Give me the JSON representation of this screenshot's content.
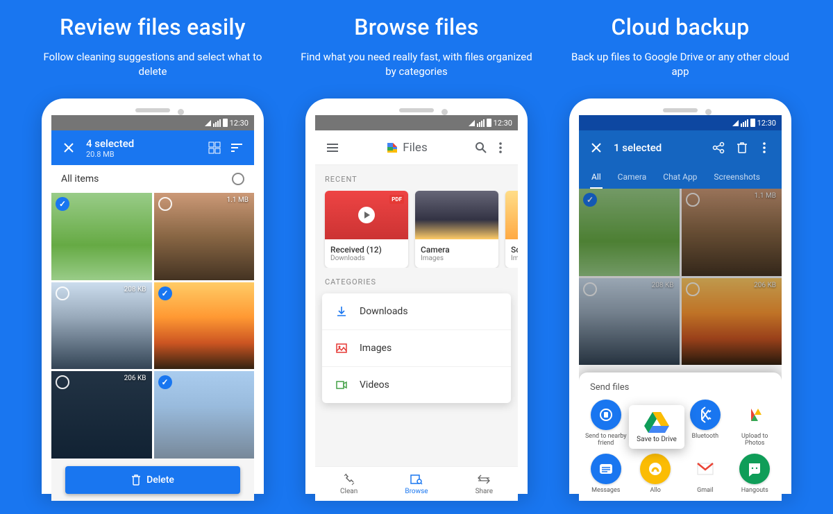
{
  "status": {
    "time": "12:30"
  },
  "panel1": {
    "title": "Review files easily",
    "subtitle": "Follow cleaning suggestions and select what to delete",
    "selected_label": "4 selected",
    "selected_size": "20.8 MB",
    "filter": "All items",
    "tiles": [
      {
        "size": "",
        "checked": true,
        "bg": "field"
      },
      {
        "size": "1.1 MB",
        "checked": false,
        "bg": "cliff"
      },
      {
        "size": "208 KB",
        "checked": false,
        "bg": "mountain"
      },
      {
        "size": "",
        "checked": true,
        "bg": "sunset"
      },
      {
        "size": "206 KB",
        "checked": false,
        "bg": "dark"
      },
      {
        "size": "",
        "checked": true,
        "bg": "city"
      }
    ],
    "delete_label": "Delete"
  },
  "panel2": {
    "title": "Browse files",
    "subtitle": "Find what you need really fast, with files organized by categories",
    "app": "Files",
    "recent_label": "RECENT",
    "recent": [
      {
        "name": "Received (12)",
        "sub": "Downloads"
      },
      {
        "name": "Camera",
        "sub": "Images"
      },
      {
        "name": "Screen",
        "sub": "Images"
      }
    ],
    "cat_label": "CATEGORIES",
    "cats": [
      {
        "icon": "download",
        "color": "#1976f0",
        "label": "Downloads"
      },
      {
        "icon": "image",
        "color": "#e53935",
        "label": "Images"
      },
      {
        "icon": "video",
        "color": "#43a047",
        "label": "Videos"
      }
    ],
    "nav": [
      {
        "label": "Clean"
      },
      {
        "label": "Browse"
      },
      {
        "label": "Share"
      }
    ]
  },
  "panel3": {
    "title": "Cloud backup",
    "subtitle": "Back up files to Google Drive or any other cloud app",
    "selected_label": "1 selected",
    "tabs": [
      "All",
      "Camera",
      "Chat App",
      "Screenshots"
    ],
    "tiles": [
      {
        "size": "",
        "checked": true,
        "bg": "field"
      },
      {
        "size": "1.1 MB",
        "checked": false,
        "bg": "cliff"
      },
      {
        "size": "208 KB",
        "checked": false,
        "bg": "mountain"
      },
      {
        "size": "206 KB",
        "checked": false,
        "bg": "sunset"
      }
    ],
    "sheet_label": "Send files",
    "drive_label": "Save to Drive",
    "share": [
      {
        "label": "Send to nearby friend",
        "bg": "#1976f0"
      },
      {
        "label": "",
        "bg": "#fff"
      },
      {
        "label": "Bluetooth",
        "bg": "#1976f0"
      },
      {
        "label": "Upload to Photos",
        "bg": "#fff"
      },
      {
        "label": "Messages",
        "bg": "#1976f0"
      },
      {
        "label": "Allo",
        "bg": "#fbbc04"
      },
      {
        "label": "Gmail",
        "bg": "#fff"
      },
      {
        "label": "Hangouts",
        "bg": "#0f9d58"
      }
    ]
  }
}
